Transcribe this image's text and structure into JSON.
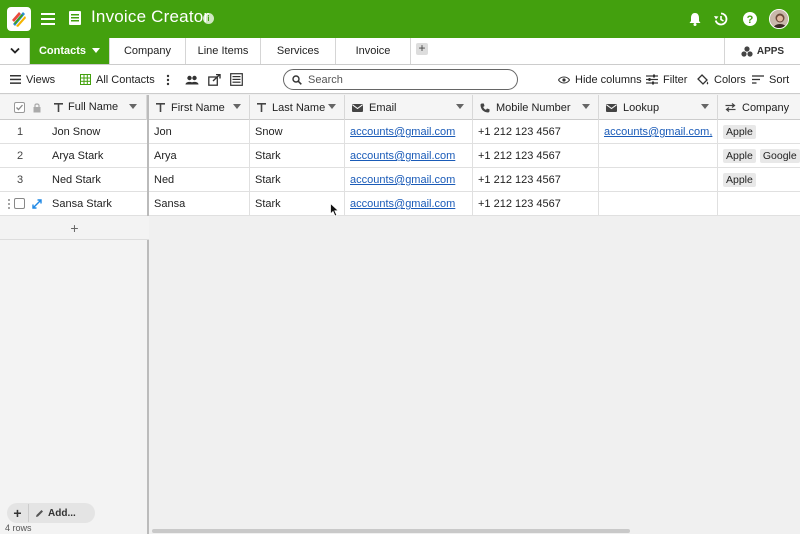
{
  "header": {
    "title": "Invoice Creator",
    "colors": {
      "brand": "#43a00e"
    },
    "icons": [
      "logo-icon",
      "menu-icon",
      "document-icon",
      "info-icon",
      "bell-icon",
      "history-icon",
      "help-icon",
      "avatar"
    ]
  },
  "tabs": {
    "items": [
      {
        "label": "Contacts",
        "active": true
      },
      {
        "label": "Company",
        "active": false
      },
      {
        "label": "Line Items",
        "active": false
      },
      {
        "label": "Services",
        "active": false
      },
      {
        "label": "Invoice",
        "active": false
      }
    ],
    "apps_label": "APPS"
  },
  "toolbar": {
    "views_label": "Views",
    "current_view": "All Contacts",
    "search_placeholder": "Search",
    "hide_columns_label": "Hide columns",
    "filter_label": "Filter",
    "colors_label": "Colors",
    "sort_label": "Sort"
  },
  "grid": {
    "frozen_column": "Full Name",
    "columns": [
      "First Name",
      "Last Name",
      "Email",
      "Mobile Number",
      "Lookup",
      "Company"
    ],
    "rows": [
      {
        "num": "1",
        "full_name": "Jon Snow",
        "first": "Jon",
        "last": "Snow",
        "email": "accounts@gmail.com",
        "mobile": "+1 212 123 4567",
        "lookup": "accounts@gmail.com,",
        "company": [
          "Apple"
        ]
      },
      {
        "num": "2",
        "full_name": "Arya Stark",
        "first": "Arya",
        "last": "Stark",
        "email": "accounts@gmail.com",
        "mobile": "+1 212 123 4567",
        "lookup": "",
        "company": [
          "Apple",
          "Google"
        ]
      },
      {
        "num": "3",
        "full_name": "Ned Stark",
        "first": "Ned",
        "last": "Stark",
        "email": "accounts@gmail.com",
        "mobile": "+1 212 123 4567",
        "lookup": "",
        "company": [
          "Apple"
        ]
      },
      {
        "num": "",
        "full_name": "Sansa Stark",
        "first": "Sansa",
        "last": "Stark",
        "email": "accounts@gmail.com",
        "mobile": "+1 212 123 4567",
        "lookup": "",
        "company": []
      }
    ]
  },
  "footer": {
    "add_label": "Add...",
    "row_count": "4 rows"
  }
}
